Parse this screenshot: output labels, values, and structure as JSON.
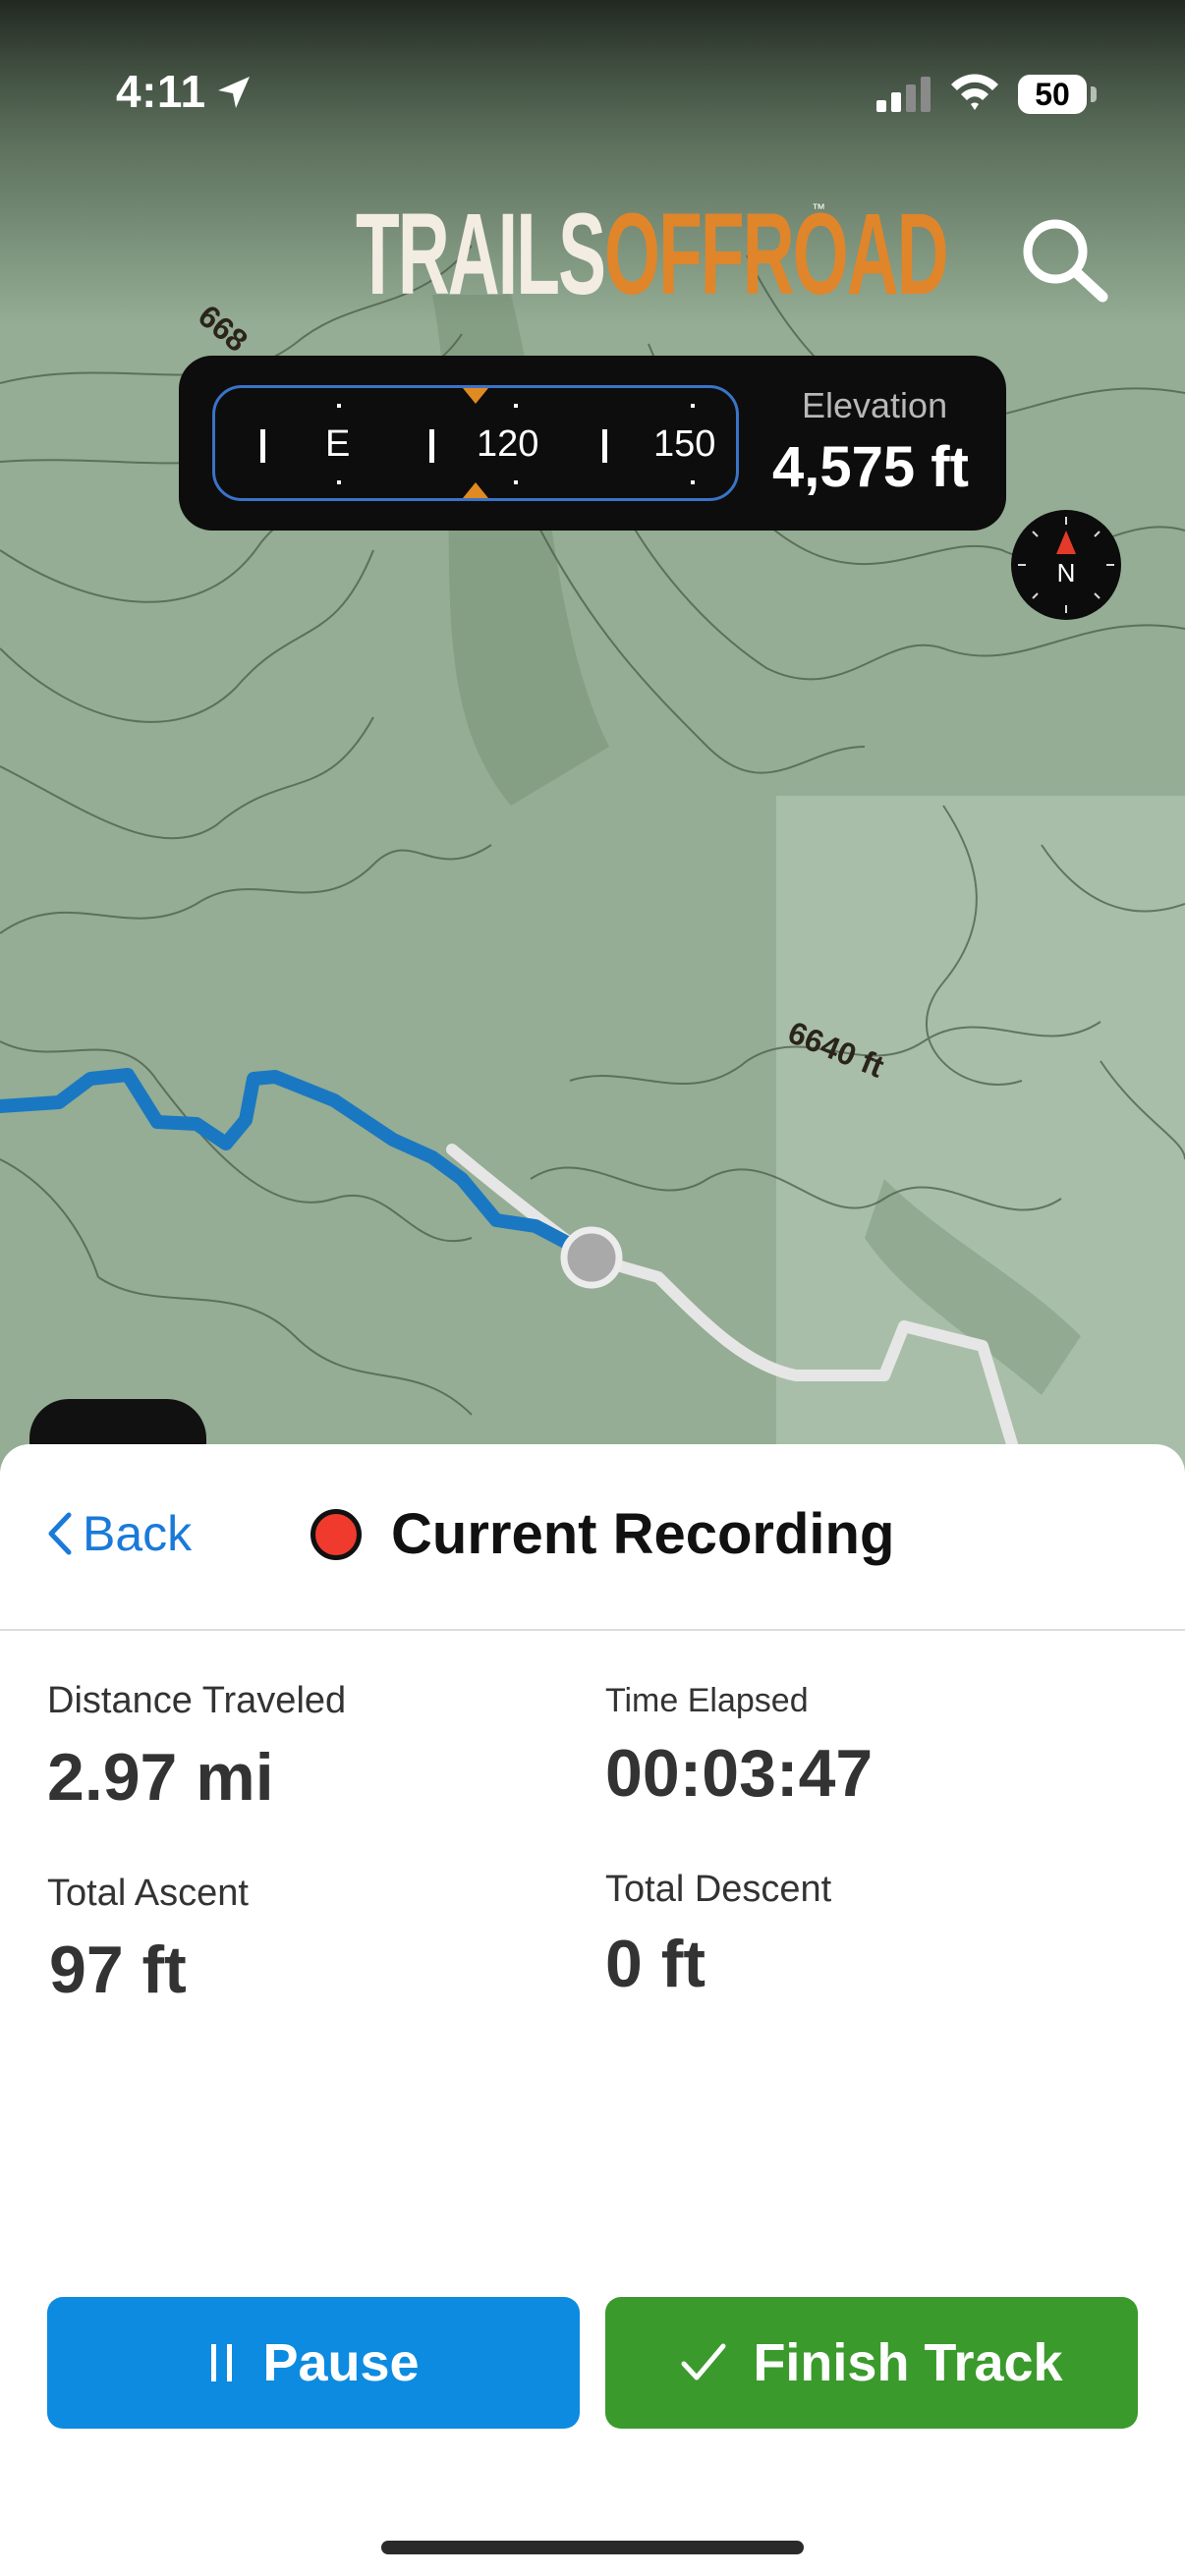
{
  "status_bar": {
    "time": "4:11",
    "battery": "50"
  },
  "app": {
    "logo_part1": "TRAILS",
    "logo_part2": "OFFROAD",
    "logo_tm": "™"
  },
  "heading": {
    "labels": [
      "E",
      "120",
      "150"
    ],
    "elevation_label": "Elevation",
    "elevation_value": "4,575 ft"
  },
  "compass": {
    "north_label": "N"
  },
  "map": {
    "contour_labels": [
      "6640 ft",
      "668"
    ]
  },
  "recording": {
    "back_label": "Back",
    "title": "Current Recording"
  },
  "stats": {
    "distance_label": "Distance Traveled",
    "distance_value": "2.97 mi",
    "time_label": "Time Elapsed",
    "time_value": "00:03:47",
    "ascent_label": "Total Ascent",
    "ascent_value": "97 ft",
    "descent_label": "Total Descent",
    "descent_value": "0 ft"
  },
  "actions": {
    "pause_label": "Pause",
    "finish_label": "Finish Track"
  },
  "colors": {
    "accent_blue": "#0c8be0",
    "finish_green": "#3a9a2c",
    "recording_red": "#f03a2e",
    "track_blue": "#1a78c2",
    "logo_orange": "#e0852a"
  }
}
